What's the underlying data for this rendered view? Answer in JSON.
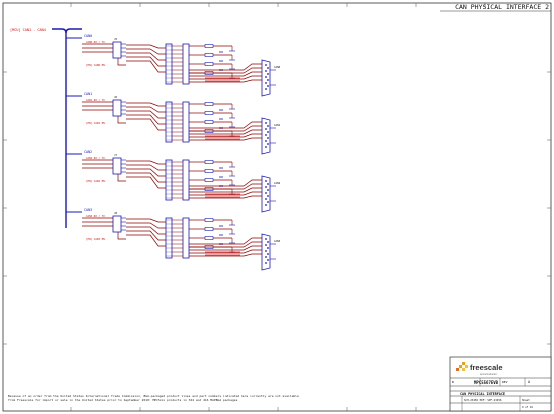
{
  "sheet": {
    "title": "CAN PHYSICAL INTERFACE 2",
    "border_labels_top": [
      "1",
      "2",
      "3",
      "4",
      "5",
      "6",
      "7",
      "8"
    ],
    "border_labels_side": [
      "A",
      "B",
      "C",
      "D",
      "E",
      "F"
    ]
  },
  "schematic": {
    "bus_label": "[MCU] CAN1 - CAN4",
    "channels": [
      {
        "name": "CAN0",
        "net_in": "CAN0_RX / TX",
        "jumper_label": "J5",
        "connector": "CAN0",
        "enable_label": "[EN] CAN0 EN"
      },
      {
        "name": "CAN1",
        "net_in": "CAN1_RX / TX",
        "jumper_label": "J6",
        "connector": "CAN1",
        "enable_label": "[EN] CAN1 EN"
      },
      {
        "name": "CAN2",
        "net_in": "CAN2_RX / TX",
        "jumper_label": "J7",
        "connector": "CAN2",
        "enable_label": "[EN] CAN2 EN"
      },
      {
        "name": "CAN3",
        "net_in": "CAN3_RX / TX",
        "jumper_label": "J8",
        "connector": "CAN3",
        "enable_label": "[EN] CAN3 EN"
      }
    ],
    "footnote": [
      "Because of an order from the United States International Trade Commission, BGA-packaged product lines and part numbers indicated here currently are not available",
      "from Freescale for import or sale in the United States prior to September 2010: MPC5xxx products in 324 and 416 MAPBGA packages"
    ]
  },
  "title_block": {
    "company": "freescale",
    "tagline": "semiconductor",
    "document_title": "MPC5567EVB",
    "sheet_title": "CAN PHYSICAL INTERFACE",
    "size_label": "B",
    "rev_label": "REV",
    "rev_value": "A",
    "doc_number": "SCH-23456  PDF: SPF-23456",
    "sheet_label": "Sheet",
    "sheet_value": "9 of 16"
  },
  "colors": {
    "wire": "#8b0000",
    "component": "#1a1ab4",
    "net_label": "#d01010",
    "border": "#333333"
  }
}
